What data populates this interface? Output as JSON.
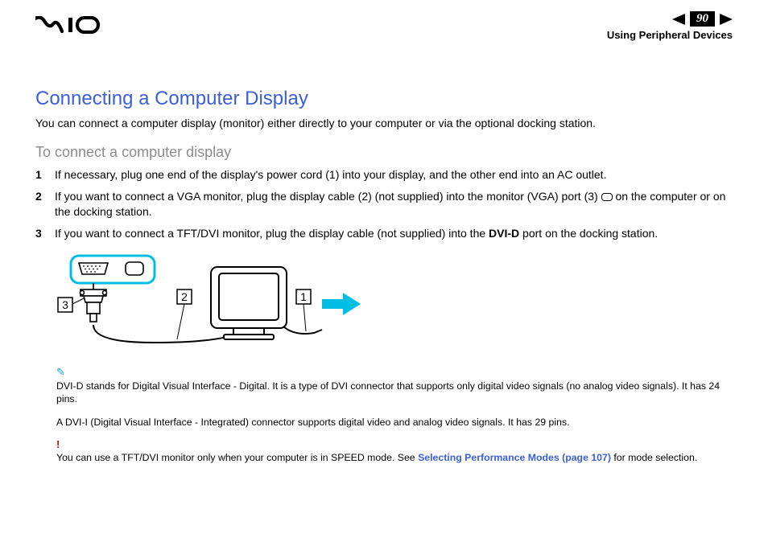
{
  "header": {
    "page_number": "90",
    "section": "Using Peripheral Devices"
  },
  "title": "Connecting a Computer Display",
  "intro": "You can connect a computer display (monitor) either directly to your computer or via the optional docking station.",
  "subhead": "To connect a computer display",
  "steps": [
    {
      "num": "1",
      "text": "If necessary, plug one end of the display's power cord (1) into your display, and the other end into an AC outlet."
    },
    {
      "num": "2",
      "text_a": "If you want to connect a VGA monitor, plug the display cable (2) (not supplied) into the monitor (VGA) port (3) ",
      "text_b": " on the computer or on the docking station."
    },
    {
      "num": "3",
      "text_a": "If you want to connect a TFT/DVI monitor, plug the display cable (not supplied) into the ",
      "bold": "DVI-D",
      "text_b": " port on the docking station."
    }
  ],
  "diagram": {
    "callouts": [
      "3",
      "2",
      "1"
    ]
  },
  "notes": {
    "pencil": "✎",
    "note1": "DVI-D stands for Digital Visual Interface - Digital. It is a type of DVI connector that supports only digital video signals (no analog video signals). It has 24 pins.",
    "note2": "A DVI-I (Digital Visual Interface - Integrated) connector supports digital video and analog video signals. It has 29 pins.",
    "warn_mark": "!",
    "warn_a": "You can use a TFT/DVI monitor only when your computer is in SPEED mode. See ",
    "warn_link": "Selecting Performance Modes (page 107)",
    "warn_b": " for mode selection."
  }
}
